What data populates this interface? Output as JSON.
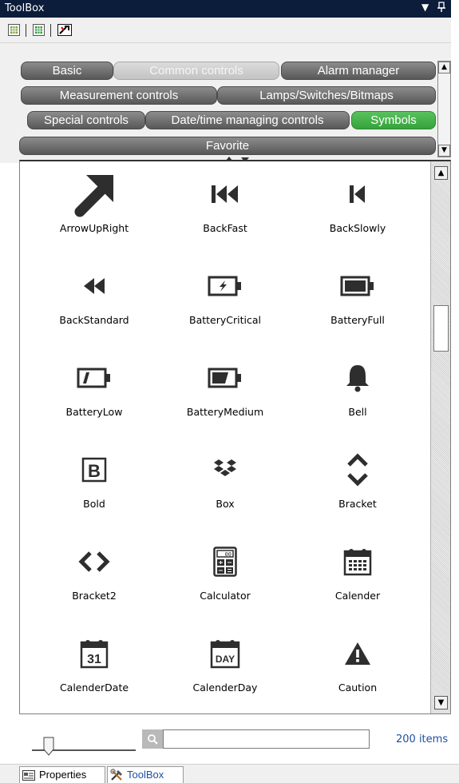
{
  "window": {
    "title": "ToolBox",
    "dropdown_icon": "▼",
    "pin_icon": "ᵖ"
  },
  "tabs": {
    "row1": [
      "Basic",
      "Common controls",
      "Alarm manager"
    ],
    "row2": [
      "Measurement controls",
      "Lamps/Switches/Bitmaps"
    ],
    "row3": [
      "Special controls",
      "Date/time managing controls",
      "Symbols"
    ],
    "row4": [
      "Favorite"
    ],
    "selected": "Symbols"
  },
  "items": [
    {
      "label": "ArrowUpRight",
      "icon": "arrow-up-right-icon"
    },
    {
      "label": "BackFast",
      "icon": "back-fast-icon"
    },
    {
      "label": "BackSlowly",
      "icon": "back-slowly-icon"
    },
    {
      "label": "BackStandard",
      "icon": "back-standard-icon"
    },
    {
      "label": "BatteryCritical",
      "icon": "battery-critical-icon"
    },
    {
      "label": "BatteryFull",
      "icon": "battery-full-icon"
    },
    {
      "label": "BatteryLow",
      "icon": "battery-low-icon"
    },
    {
      "label": "BatteryMedium",
      "icon": "battery-medium-icon"
    },
    {
      "label": "Bell",
      "icon": "bell-icon"
    },
    {
      "label": "Bold",
      "icon": "bold-icon"
    },
    {
      "label": "Box",
      "icon": "box-icon"
    },
    {
      "label": "Bracket",
      "icon": "bracket-icon"
    },
    {
      "label": "Bracket2",
      "icon": "bracket2-icon"
    },
    {
      "label": "Calculator",
      "icon": "calculator-icon"
    },
    {
      "label": "Calender",
      "icon": "calender-icon"
    },
    {
      "label": "CalenderDate",
      "icon": "calender-date-icon"
    },
    {
      "label": "CalenderDay",
      "icon": "calender-day-icon"
    },
    {
      "label": "Caution",
      "icon": "caution-icon"
    }
  ],
  "glyph_text": {
    "bold": "B",
    "calendar_date": "31",
    "calendar_day": "DAY",
    "calculator_display": "00"
  },
  "footer": {
    "search_value": "",
    "item_count": "200 items"
  },
  "bottom_tabs": {
    "properties": "Properties",
    "toolbox": "ToolBox"
  },
  "colors": {
    "titlebar": "#0b1d3a",
    "tab_dark": "#6a6a6a",
    "tab_selected": "#3fad45",
    "count_text": "#1f4fa3"
  }
}
